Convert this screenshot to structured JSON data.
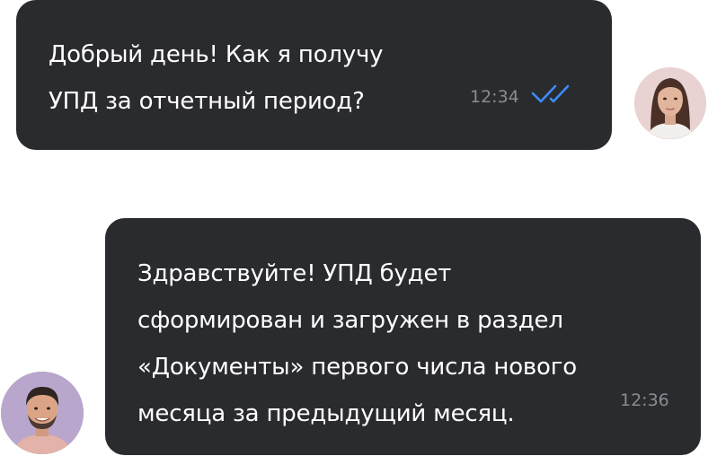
{
  "messages": [
    {
      "id": "msg1",
      "sender": "user",
      "lines": [
        "Добрый день! Как я получу",
        "УПД за отчетный период?"
      ],
      "time": "12:34",
      "status_icon": "double-check-icon",
      "status_color": "#3d8cf5"
    },
    {
      "id": "msg2",
      "sender": "support",
      "lines": [
        "Здравствуйте! УПД будет",
        "сформирован и загружен в раздел",
        "«Документы» первого числа нового",
        "месяца за предыдущий месяц."
      ],
      "time": "12:36"
    }
  ],
  "colors": {
    "bubble_bg": "#2a2b2f",
    "text": "#ffffff",
    "time": "#8b8c90",
    "check": "#3d8cf5"
  }
}
